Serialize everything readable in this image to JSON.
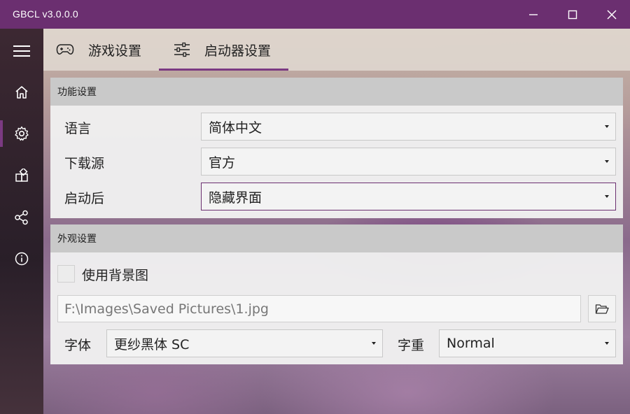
{
  "window": {
    "title": "GBCL v3.0.0.0",
    "controls": {
      "minimize_icon": "minimize-icon",
      "maximize_icon": "maximize-icon",
      "close_icon": "close-icon"
    }
  },
  "sidebar": {
    "items": [
      {
        "icon": "menu-icon",
        "active": false
      },
      {
        "icon": "home-icon",
        "active": false
      },
      {
        "icon": "gear-icon",
        "active": true
      },
      {
        "icon": "extensions-icon",
        "active": false
      },
      {
        "icon": "share-icon",
        "active": false
      },
      {
        "icon": "info-icon",
        "active": false
      }
    ]
  },
  "tabs": [
    {
      "label": "游戏设置",
      "icon": "gamepad-icon",
      "selected": false
    },
    {
      "label": "启动器设置",
      "icon": "sliders-icon",
      "selected": true
    }
  ],
  "function_settings": {
    "header": "功能设置",
    "language": {
      "label": "语言",
      "value": "简体中文"
    },
    "download_source": {
      "label": "下载源",
      "value": "官方"
    },
    "after_launch": {
      "label": "启动后",
      "value": "隐藏界面"
    }
  },
  "appearance_settings": {
    "header": "外观设置",
    "use_background": {
      "label": "使用背景图",
      "checked": false
    },
    "background_path": {
      "value": "F:\\Images\\Saved Pictures\\1.jpg"
    },
    "font": {
      "label": "字体",
      "value": "更纱黑体 SC"
    },
    "weight": {
      "label": "字重",
      "value": "Normal"
    }
  },
  "colors": {
    "accent": "#6b2f70",
    "panel_header": "#c9c9c9"
  }
}
